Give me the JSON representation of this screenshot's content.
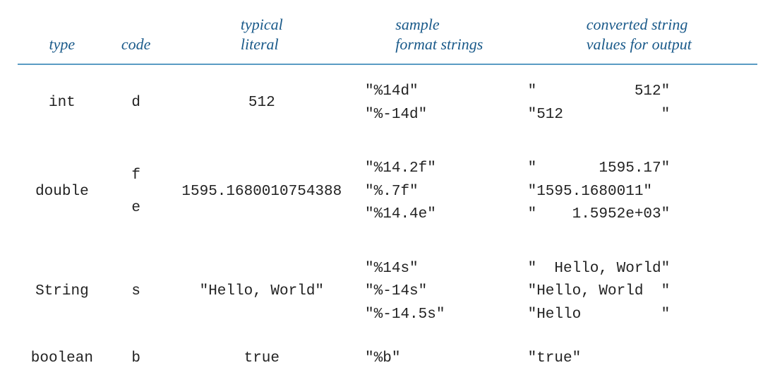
{
  "headers": {
    "type": "type",
    "code": "code",
    "literal": "typical\nliteral",
    "formats": "sample\nformat strings",
    "outputs": "converted string\nvalues for output"
  },
  "rows": [
    {
      "type": "int",
      "code": "d",
      "literal": "512",
      "formats": "\"%14d\"\n\"%-14d\"",
      "outputs": "\"           512\"\n\"512           \""
    },
    {
      "type": "double",
      "code": "f\ne",
      "literal": "1595.1680010754388",
      "formats": "\"%14.2f\"\n\"%.7f\"\n\"%14.4e\"",
      "outputs": "\"       1595.17\"\n\"1595.1680011\"\n\"    1.5952e+03\""
    },
    {
      "type": "String",
      "code": "s",
      "literal": "\"Hello, World\"",
      "formats": "\"%14s\"\n\"%-14s\"\n\"%-14.5s\"",
      "outputs": "\"  Hello, World\"\n\"Hello, World  \"\n\"Hello         \""
    },
    {
      "type": "boolean",
      "code": "b",
      "literal": "true",
      "formats": "\"%b\"",
      "outputs": "\"true\""
    }
  ]
}
